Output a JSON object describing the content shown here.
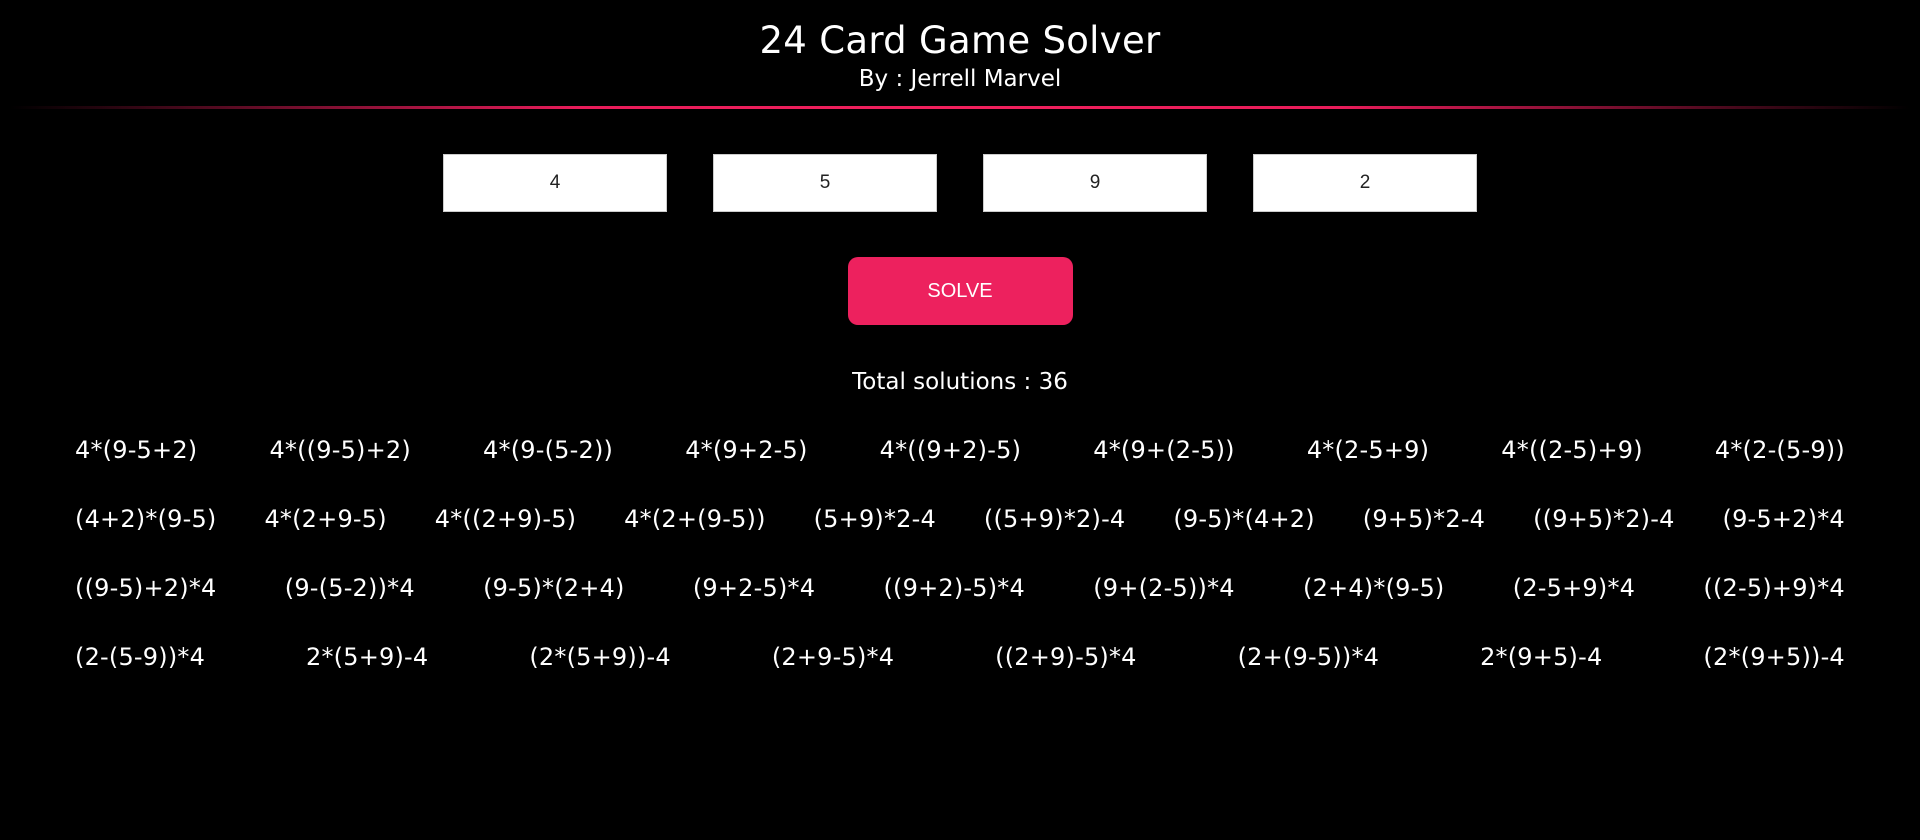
{
  "header": {
    "title": "24 Card Game Solver",
    "subtitle": "By : Jerrell Marvel"
  },
  "inputs": [
    "4",
    "5",
    "9",
    "2"
  ],
  "solve": {
    "label": "SOLVE"
  },
  "total_label": "Total solutions : 36",
  "colors": {
    "accent": "#ed215e",
    "background": "#000000",
    "text": "#ffffff"
  },
  "solutions": [
    [
      "4*(9-5+2)",
      "4*((9-5)+2)",
      "4*(9-(5-2))",
      "4*(9+2-5)",
      "4*((9+2)-5)",
      "4*(9+(2-5))",
      "4*(2-5+9)",
      "4*((2-5)+9)",
      "4*(2-(5-9))"
    ],
    [
      "(4+2)*(9-5)",
      "4*(2+9-5)",
      "4*((2+9)-5)",
      "4*(2+(9-5))",
      "(5+9)*2-4",
      "((5+9)*2)-4",
      "(9-5)*(4+2)",
      "(9+5)*2-4",
      "((9+5)*2)-4",
      "(9-5+2)*4"
    ],
    [
      "((9-5)+2)*4",
      "(9-(5-2))*4",
      "(9-5)*(2+4)",
      "(9+2-5)*4",
      "((9+2)-5)*4",
      "(9+(2-5))*4",
      "(2+4)*(9-5)",
      "(2-5+9)*4",
      "((2-5)+9)*4"
    ],
    [
      "(2-(5-9))*4",
      "2*(5+9)-4",
      "(2*(5+9))-4",
      "(2+9-5)*4",
      "((2+9)-5)*4",
      "(2+(9-5))*4",
      "2*(9+5)-4",
      "(2*(9+5))-4"
    ]
  ]
}
